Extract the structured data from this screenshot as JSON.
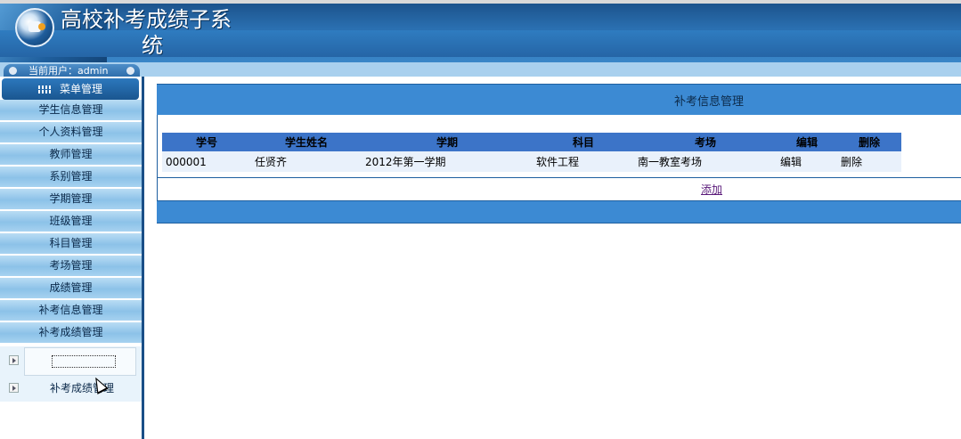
{
  "app": {
    "title_line1": "高校补考成绩子系",
    "title_line2": "统"
  },
  "userbar": {
    "label": "当前用户：admin"
  },
  "sidebar": {
    "header": "菜单管理",
    "items": [
      {
        "label": "学生信息管理"
      },
      {
        "label": "个人资料管理"
      },
      {
        "label": "教师管理"
      },
      {
        "label": "系别管理"
      },
      {
        "label": "学期管理"
      },
      {
        "label": "班级管理"
      },
      {
        "label": "科目管理"
      },
      {
        "label": "考场管理"
      },
      {
        "label": "成绩管理"
      },
      {
        "label": "补考信息管理"
      },
      {
        "label": "补考成绩管理"
      }
    ],
    "submenu": {
      "item2_label": "补考成绩管理"
    }
  },
  "main": {
    "title": "补考信息管理",
    "table": {
      "headers": [
        "学号",
        "学生姓名",
        "学期",
        "科目",
        "考场",
        "编辑",
        "删除"
      ],
      "rows": [
        {
          "id": "000001",
          "name": "任贤齐",
          "term": "2012年第一学期",
          "subject": "软件工程",
          "room": "南一教室考场",
          "edit": "编辑",
          "delete": "删除"
        }
      ]
    },
    "add_label": "添加"
  },
  "colors": {
    "header_blue": "#2a6fb0",
    "panel_blue": "#3c8ad3",
    "table_header": "#3c74c8",
    "menu_item": "#8cc2e8"
  }
}
